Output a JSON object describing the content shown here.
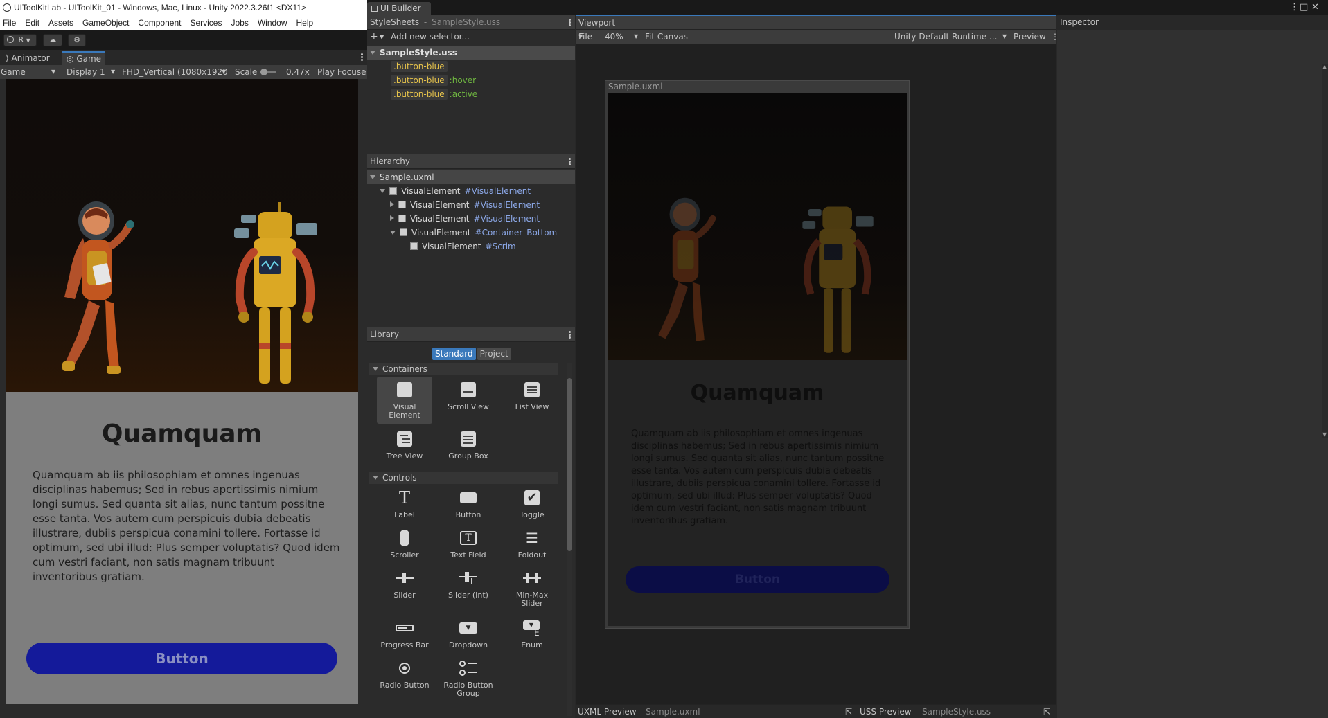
{
  "unity": {
    "window_title": "UIToolKitLab - UIToolKit_01 - Windows, Mac, Linux - Unity 2022.3.26f1 <DX11>",
    "menu": [
      "File",
      "Edit",
      "Assets",
      "GameObject",
      "Component",
      "Services",
      "Jobs",
      "Window",
      "Help"
    ],
    "account_initial": "R",
    "tabs": {
      "animator": "Animator",
      "game": "Game"
    },
    "game_options": {
      "mode": "Game",
      "display": "Display 1",
      "resolution": "FHD_Vertical (1080x1920",
      "scale_label": "Scale",
      "scale_value": "0.47x",
      "play_focus": "Play Focuse"
    },
    "scale_level": 0.05
  },
  "sample_ui": {
    "title": "Quamquam",
    "body": "Quamquam ab iis philosophiam et omnes ingenuas disciplinas habemus; Sed in rebus apertissimis nimium longi sumus. Sed quanta sit alias, nunc tantum possitne esse tanta. Vos autem cum perspicuis dubia debeatis illustrare, dubiis perspicua conamini tollere. Fortasse id optimum, sed ubi illud: Plus semper voluptatis? Quod idem cum vestri faciant, non satis magnam tribuunt inventoribus gratiam.",
    "button": "Button",
    "colors": {
      "button_bright": "#141a9a",
      "button_dim": "#0b0d46",
      "panel_bright": "#7e7e7e",
      "panel_dim": "#232323"
    }
  },
  "ui_builder": {
    "tab_title": "UI Builder",
    "stylesheets": {
      "header": "StyleSheets",
      "separator": "-",
      "file": "SampleStyle.uss",
      "add_selector": "Add new selector...",
      "sheet_name": "SampleStyle.uss",
      "selectors": [
        {
          "name": ".button-blue",
          "pseudo": ""
        },
        {
          "name": ".button-blue",
          "pseudo": ":hover"
        },
        {
          "name": ".button-blue",
          "pseudo": ":active"
        }
      ]
    },
    "hierarchy": {
      "header": "Hierarchy",
      "root": "Sample.uxml",
      "items": [
        {
          "name": "VisualElement",
          "id": "#VisualElement"
        },
        {
          "name": "VisualElement",
          "id": "#VisualElement"
        },
        {
          "name": "VisualElement",
          "id": "#VisualElement"
        },
        {
          "name": "VisualElement",
          "id": "#Container_Bottom"
        },
        {
          "name": "VisualElement",
          "id": "#Scrim"
        }
      ]
    },
    "library": {
      "header": "Library",
      "tabs": [
        "Standard",
        "Project"
      ],
      "containers_label": "Containers",
      "containers": [
        "Visual Element",
        "Scroll View",
        "List View",
        "Tree View",
        "Group Box"
      ],
      "controls_label": "Controls",
      "controls": [
        "Label",
        "Button",
        "Toggle",
        "Scroller",
        "Text Field",
        "Foldout",
        "Slider",
        "Slider (Int)",
        "Min-Max Slider",
        "Progress Bar",
        "Dropdown",
        "Enum",
        "Radio Button",
        "Radio Button Group"
      ]
    },
    "viewport": {
      "header": "Viewport",
      "file_menu": "File",
      "zoom": "40%",
      "fit_canvas": "Fit Canvas",
      "theme": "Unity Default Runtime ...",
      "preview": "Preview",
      "canvas_label": "Sample.uxml"
    },
    "inspector": {
      "header": "Inspector"
    },
    "bottom": {
      "uxml_label": "UXML Preview",
      "uxml_file": "Sample.uxml",
      "uss_label": "USS Preview",
      "uss_file": "SampleStyle.uss"
    }
  }
}
